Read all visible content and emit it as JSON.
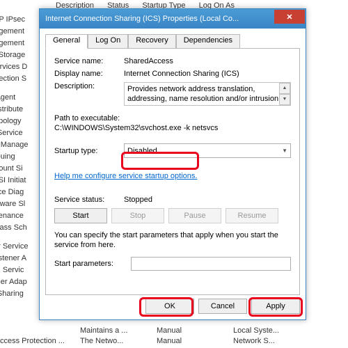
{
  "background": {
    "columns": [
      "Description",
      "Status",
      "Startup Type",
      "Log On As"
    ],
    "services_left": [
      "uthIP IPsec",
      "anagement",
      "anagement",
      "pid Storage",
      "t Services D",
      "onnection S",
      "",
      "cy Agent",
      "r Distribute",
      "r Topology",
      "ter Service",
      "tion Manage",
      "Queuing",
      "Account Si",
      "iSCSI Initiat",
      "Office Diag",
      "Software Sl",
      "aintenance",
      "a Class Sch",
      "",
      "cker Service",
      "g Listener A",
      "loud Servic",
      "stener Adap",
      "ort Sharing"
    ],
    "dividers": [
      115,
      345
    ],
    "bottom_rows": [
      {
        "name": "ccess Protection ...",
        "desc": "The Netwo...",
        "startup": "Manual",
        "logon": "Network S..."
      },
      {
        "name": "",
        "desc": "Maintains a ...",
        "startup": "Manual",
        "logon": "Local Syste..."
      }
    ]
  },
  "dialog": {
    "title": "Internet Connection Sharing (ICS) Properties (Local Co...",
    "tabs": [
      "General",
      "Log On",
      "Recovery",
      "Dependencies"
    ],
    "service_name_label": "Service name:",
    "service_name": "SharedAccess",
    "display_name_label": "Display name:",
    "display_name": "Internet Connection Sharing (ICS)",
    "description_label": "Description:",
    "description": "Provides network address translation, addressing, name resolution and/or intrusion prevention services",
    "path_label": "Path to executable:",
    "path": "C:\\WINDOWS\\System32\\svchost.exe -k netsvcs",
    "startup_label": "Startup type:",
    "startup_value": "Disabled",
    "help_link": "Help me configure service startup options.",
    "status_label": "Service status:",
    "status": "Stopped",
    "btn_start": "Start",
    "btn_stop": "Stop",
    "btn_pause": "Pause",
    "btn_resume": "Resume",
    "note": "You can specify the start parameters that apply when you start the service from here.",
    "params_label": "Start parameters:",
    "ok": "OK",
    "cancel": "Cancel",
    "apply": "Apply"
  }
}
